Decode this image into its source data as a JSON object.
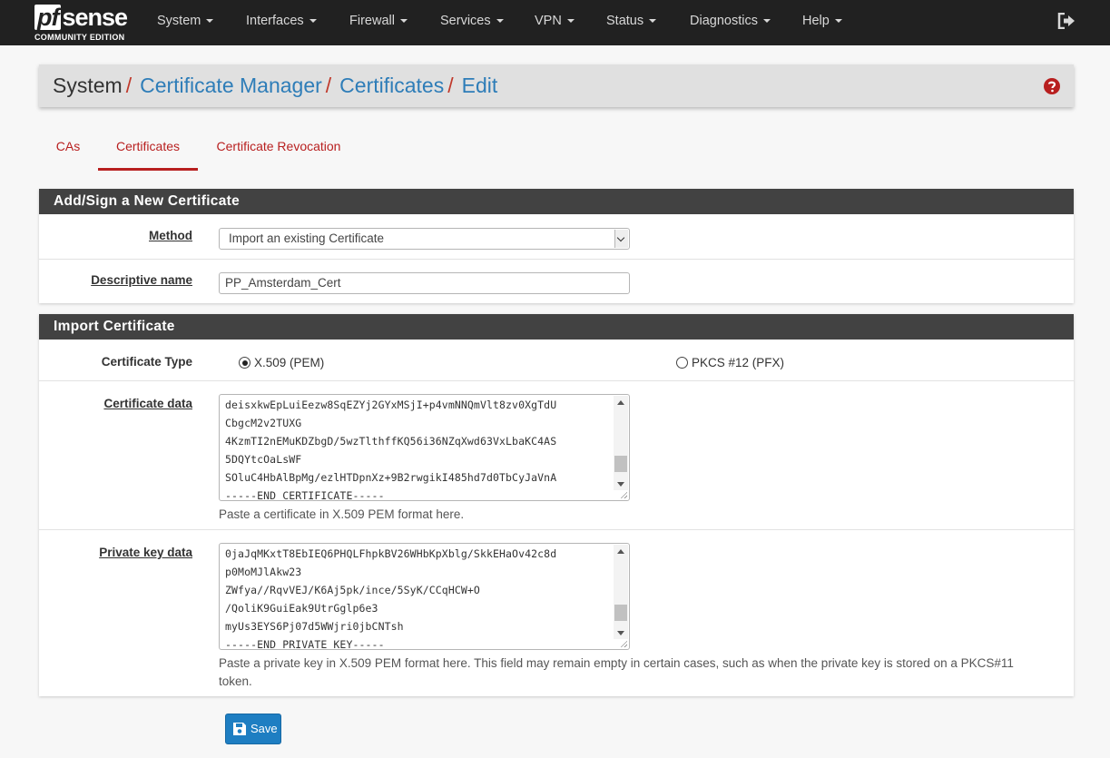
{
  "brand": {
    "name_pf": "pf",
    "name_sense": "sense",
    "edition": "COMMUNITY EDITION"
  },
  "nav": {
    "items": [
      "System",
      "Interfaces",
      "Firewall",
      "Services",
      "VPN",
      "Status",
      "Diagnostics",
      "Help"
    ],
    "logout_icon": "sign-out-icon"
  },
  "breadcrumb": {
    "root": "System",
    "links": [
      "Certificate Manager",
      "Certificates",
      "Edit"
    ],
    "separator": "/",
    "help_icon": "question-circle-icon"
  },
  "tabs": [
    {
      "label": "CAs",
      "active": false
    },
    {
      "label": "Certificates",
      "active": true
    },
    {
      "label": "Certificate Revocation",
      "active": false
    }
  ],
  "section_new": {
    "heading": "Add/Sign a New Certificate",
    "method_label": "Method",
    "method_value": "Import an existing Certificate",
    "descr_label": "Descriptive name",
    "descr_value": "PP_Amsterdam_Cert"
  },
  "section_import": {
    "heading": "Import Certificate",
    "type_label": "Certificate Type",
    "type_options": [
      "X.509 (PEM)",
      "PKCS #12 (PFX)"
    ],
    "type_selected": "X.509 (PEM)",
    "cert_label": "Certificate data",
    "cert_lines": [
      "deisxkwEpLuiEezw8SqEZYj2GYxMSjI+p4vmNNQmVlt8zv0XgTdU",
      "CbgcM2v2TUXG",
      "4KzmTI2nEMuKDZbgD/5wzTlthffKQ56i36NZqXwd63VxLbaKC4AS",
      "5DQYtcOaLsWF",
      "SOluC4HbAlBpMg/ezlHTDpnXz+9B2rwgikI485hd7d0TbCyJaVnA",
      "-----END CERTIFICATE-----"
    ],
    "cert_help": "Paste a certificate in X.509 PEM format here.",
    "key_label": "Private key data",
    "key_lines": [
      "0jaJqMKxtT8EbIEQ6PHQLFhpkBV26WHbKpXblg/SkkEHaOv42c8d",
      "p0MoMJlAkw23",
      "ZWfya//RqvVEJ/K6Aj5pk/ince/5SyK/CCqHCW+O",
      "/QoliK9GuiEak9UtrGglp6e3",
      "myUs3EYS6Pj07d5WWjri0jbCNTsh",
      "-----END PRIVATE KEY-----"
    ],
    "key_help": "Paste a private key in X.509 PEM format here. This field may remain empty in certain cases, such as when the private key is stored on a PKCS#11 token."
  },
  "save_button": {
    "label": "Save",
    "icon": "floppy-disk-icon"
  },
  "colors": {
    "accent_red": "#b81f1f",
    "link_blue": "#2e7db8",
    "navbar": "#212121",
    "heading_bar": "#424242",
    "save_blue": "#1e7ec2"
  }
}
